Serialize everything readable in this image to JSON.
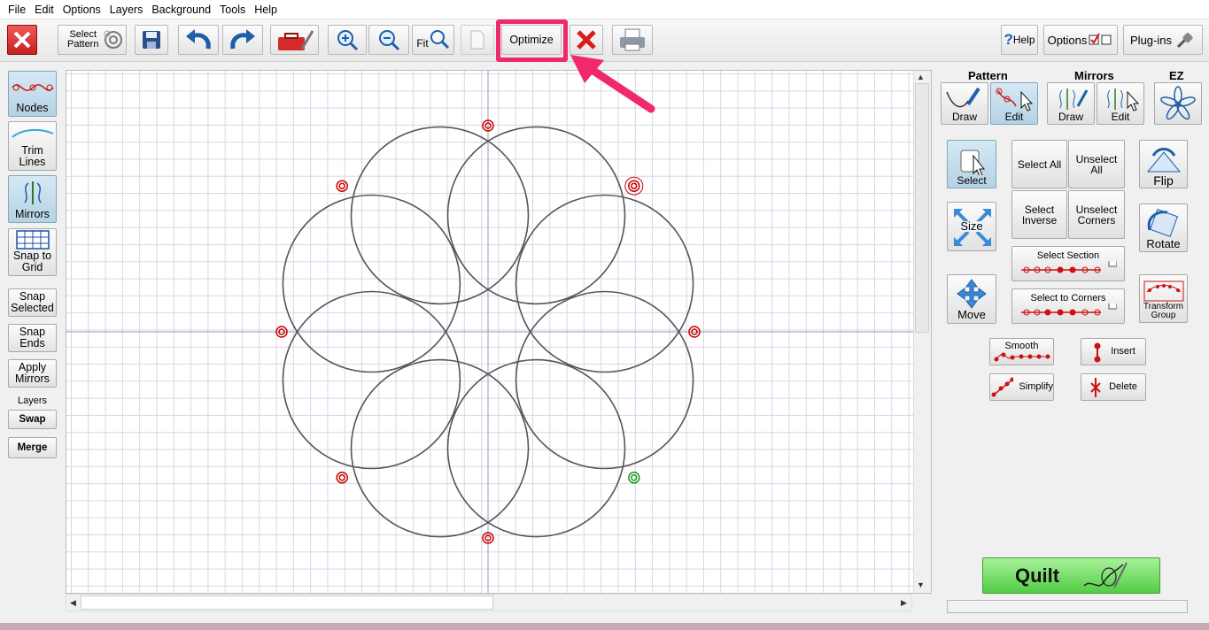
{
  "menubar": {
    "items": [
      "File",
      "Edit",
      "Options",
      "Layers",
      "Background",
      "Tools",
      "Help"
    ]
  },
  "toolbar": {
    "select_pattern_line1": "Select",
    "select_pattern_line2": "Pattern",
    "fit_label": "Fit",
    "optimize_label": "Optimize",
    "help_label": "Help",
    "help_mark": "?",
    "options_label": "Options",
    "plugins_label": "Plug-ins"
  },
  "left_panel": {
    "nodes": "Nodes",
    "trim_lines_1": "Trim",
    "trim_lines_2": "Lines",
    "mirrors": "Mirrors",
    "snap_to_grid_1": "Snap to",
    "snap_to_grid_2": "Grid",
    "snap_selected_1": "Snap",
    "snap_selected_2": "Selected",
    "snap_ends_1": "Snap",
    "snap_ends_2": "Ends",
    "apply_mirrors_1": "Apply",
    "apply_mirrors_2": "Mirrors",
    "layers_label": "Layers",
    "swap": "Swap",
    "merge": "Merge"
  },
  "right_panel": {
    "pattern_header": "Pattern",
    "mirrors_header": "Mirrors",
    "ez_header": "EZ",
    "pattern_draw": "Draw",
    "pattern_edit": "Edit",
    "mirrors_draw": "Draw",
    "mirrors_edit": "Edit",
    "select": "Select",
    "select_all": "Select All",
    "unselect_all_1": "Unselect",
    "unselect_all_2": "All",
    "flip": "Flip",
    "size": "Size",
    "select_inverse_1": "Select",
    "select_inverse_2": "Inverse",
    "unselect_corners_1": "Unselect",
    "unselect_corners_2": "Corners",
    "rotate": "Rotate",
    "select_section": "Select Section",
    "move": "Move",
    "select_to_corners": "Select to Corners",
    "transform_group_1": "Transform",
    "transform_group_2": "Group",
    "smooth": "Smooth",
    "insert": "Insert",
    "simplify": "Simplify",
    "delete": "Delete"
  },
  "quilt": {
    "label": "Quilt"
  },
  "colors": {
    "highlight": "#f0286c",
    "node_red": "#cc0000",
    "node_green": "#1a9a1a",
    "stroke": "#555555",
    "quilt_green": "#52cc45"
  }
}
